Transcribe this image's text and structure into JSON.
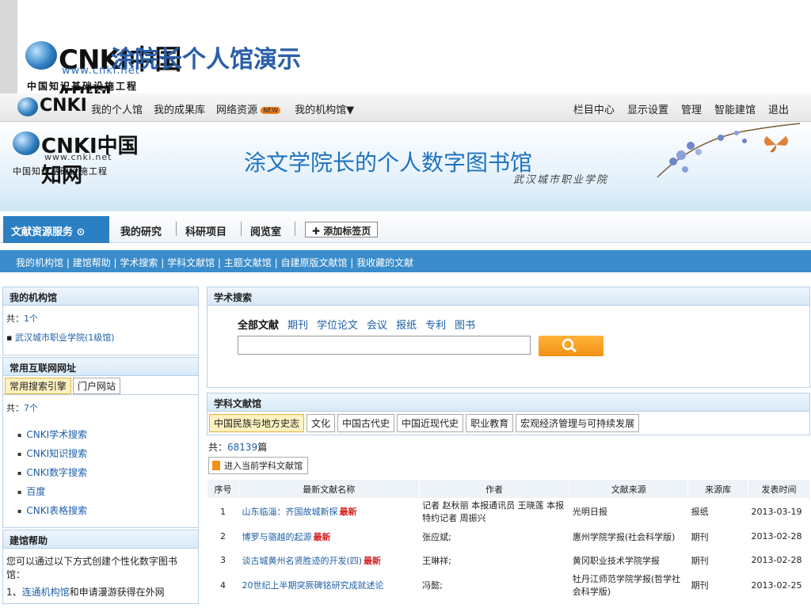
{
  "slide": {
    "title": "涂院长个人馆演示",
    "logo_text": "CNKI中国知网",
    "logo_url": "www.cnki.net",
    "logo_sub": "中国知识基础设施工程"
  },
  "topbar": {
    "logo": "CNKI",
    "nav": [
      "我的个人馆",
      "我的成果库",
      "网络资源",
      "我的机构馆▼"
    ],
    "new_badge": "NEW",
    "right": [
      "栏目中心",
      "显示设置",
      "管理",
      "智能建馆",
      "退出"
    ]
  },
  "banner": {
    "logo": "CNKI中国知网",
    "logo_url": "www.cnki.net",
    "logo_sub": "中国知识基础设施工程",
    "title": "涂文学院长的个人数字图书馆",
    "subtitle": "武汉城市职业学院"
  },
  "nav2": {
    "active": "文献资源服务 ⊙",
    "items": [
      "我的研究",
      "科研项目",
      "阅览室"
    ],
    "add_tab": "添加标签页"
  },
  "subnav": {
    "items": [
      "我的机构馆",
      "建馆帮助",
      "学术搜索",
      "学科文献馆",
      "主题文献馆",
      "自建原版文献馆",
      "我收藏的文献"
    ],
    "separator": " | "
  },
  "left": {
    "institution": {
      "head": "我的机构馆",
      "count_label": "共：",
      "count": "1个",
      "item": "武汉城市职业学院(1级馆)"
    },
    "links": {
      "head": "常用互联网网址",
      "tabs": [
        "常用搜索引擎",
        "门户网站"
      ],
      "count_label": "共：",
      "count": "7个",
      "items": [
        "CNKI学术搜索",
        "CNKI知识搜索",
        "CNKI数字搜索",
        "百度",
        "CNKI表格搜索"
      ]
    },
    "help": {
      "head": "建馆帮助",
      "text": "您可以通过以下方式创建个性化数字图书馆：",
      "item1_prefix": "1、",
      "item1_link": "连通机构馆",
      "item1_rest": "和申请漫游获得在外网"
    }
  },
  "search": {
    "head": "学术搜索",
    "scopes": [
      "全部文献",
      "期刊",
      "学位论文",
      "会议",
      "报纸",
      "专利",
      "图书"
    ],
    "input_value": ""
  },
  "subject": {
    "head": "学科文献馆",
    "tabs": [
      "中国民族与地方史志",
      "文化",
      "中国古代史",
      "中国近现代史",
      "职业教育",
      "宏观经济管理与可持续发展"
    ],
    "total_label": "共：",
    "total": "68139",
    "total_unit": "篇",
    "enter": "进入当前学科文献馆",
    "columns": [
      "序号",
      "最新文献名称",
      "作者",
      "文献来源",
      "来源库",
      "发表时间"
    ],
    "hot_label": "最新",
    "rows": [
      {
        "no": "1",
        "title": "山东临淄：齐国故城新探",
        "hot": true,
        "author": "记者 赵秋丽 本报通讯员 王晓莲 本报特约记者 周振兴",
        "source": "光明日报",
        "db": "报纸",
        "date": "2013-03-19"
      },
      {
        "no": "2",
        "title": "博罗与骆越的起源",
        "hot": true,
        "author": "张应斌;",
        "source": "惠州学院学报(社会科学版)",
        "db": "期刊",
        "date": "2013-02-28"
      },
      {
        "no": "3",
        "title": "谈古城黄州名贤胜迹的开发(四)",
        "hot": true,
        "author": "王琳祥;",
        "source": "黄冈职业技术学院学报",
        "db": "期刊",
        "date": "2013-02-28"
      },
      {
        "no": "4",
        "title": "20世纪上半期突厥碑铭研究成就述论",
        "hot": false,
        "author": "冯懿;",
        "source": "牡丹江师范学院学报(哲学社会科学版)",
        "db": "期刊",
        "date": "2013-02-25"
      }
    ]
  },
  "colors": {
    "accent": "#2b7fc3",
    "title_blue": "#1f73c0",
    "hot": "#d42020",
    "search_btn": "#f39114"
  },
  "icons": [
    "globe-logo-icon",
    "new-badge-icon",
    "circle-down-icon",
    "plus-icon",
    "search-icon",
    "enter-icon",
    "flower-decoration-icon",
    "butterfly-icon"
  ]
}
